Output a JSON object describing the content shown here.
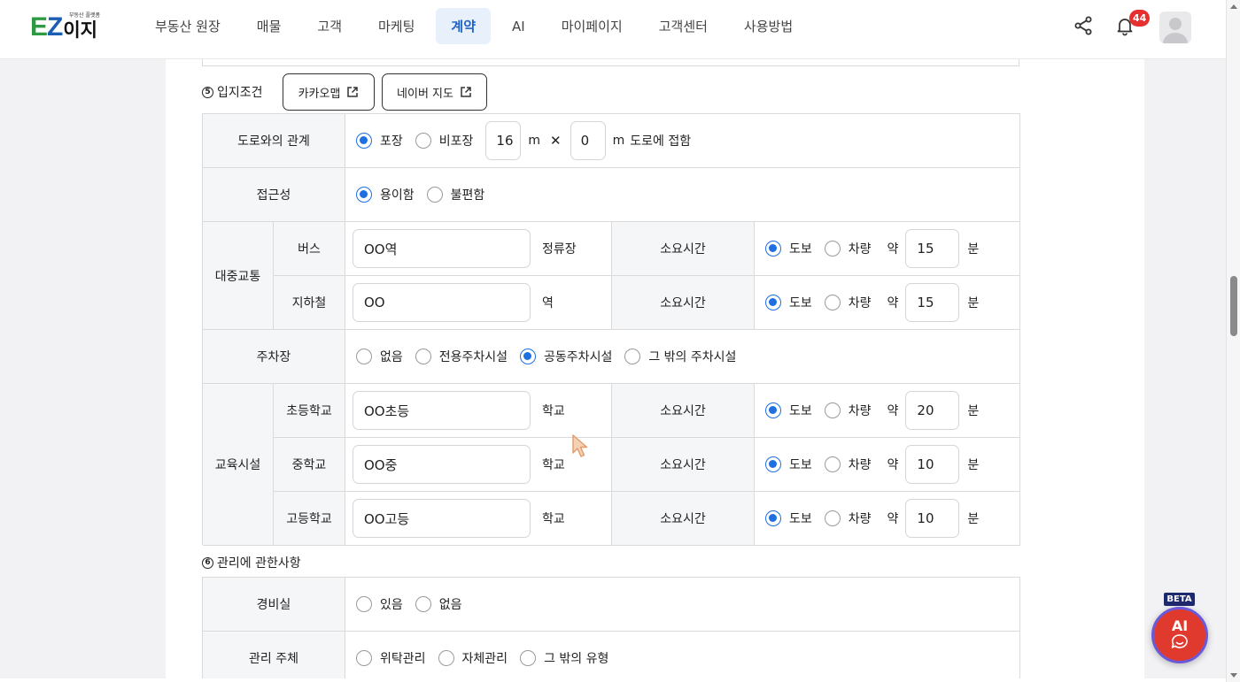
{
  "header": {
    "logo_ez": "EZ",
    "logo_ko": "이지",
    "logo_sub": "부동산 플랫폼",
    "nav": [
      {
        "label": "부동산 원장"
      },
      {
        "label": "매물"
      },
      {
        "label": "고객"
      },
      {
        "label": "마케팅"
      },
      {
        "label": "계약",
        "active": true
      },
      {
        "label": "AI"
      },
      {
        "label": "마이페이지"
      },
      {
        "label": "고객센터"
      },
      {
        "label": "사용방법"
      }
    ],
    "notification_count": "44",
    "icons": {
      "share": "share-icon",
      "bell": "bell-icon",
      "avatar": "user-avatar-icon"
    }
  },
  "section5": {
    "num": "5",
    "title": "입지조건",
    "kakao_btn": "카카오맵",
    "naver_btn": "네이버 지도"
  },
  "road": {
    "label": "도로와의 관계",
    "opt1": "포장",
    "opt2": "비포장",
    "width": "16",
    "m1": "m",
    "x": "✕",
    "depth": "0",
    "m2": "m",
    "suffix": "도로에 접함",
    "selected": "포장"
  },
  "access": {
    "label": "접근성",
    "opt1": "용이함",
    "opt2": "불편함",
    "selected": "용이함"
  },
  "transit": {
    "label": "대중교통",
    "rows": [
      {
        "label": "버스",
        "value": "OO역",
        "unit": "정류장",
        "time_label": "소요시간",
        "opt1": "도보",
        "opt2": "차량",
        "approx": "약",
        "minutes": "15",
        "min_unit": "분"
      },
      {
        "label": "지하철",
        "value": "OO",
        "unit": "역",
        "time_label": "소요시간",
        "opt1": "도보",
        "opt2": "차량",
        "approx": "약",
        "minutes": "15",
        "min_unit": "분"
      }
    ]
  },
  "parking": {
    "label": "주차장",
    "options": [
      "없음",
      "전용주차시설",
      "공동주차시설",
      "그 밖의 주차시설"
    ],
    "selected": "공동주차시설"
  },
  "education": {
    "label": "교육시설",
    "rows": [
      {
        "label": "초등학교",
        "value": "OO초등",
        "unit": "학교",
        "time_label": "소요시간",
        "opt1": "도보",
        "opt2": "차량",
        "approx": "약",
        "minutes": "20",
        "min_unit": "분"
      },
      {
        "label": "중학교",
        "value": "OO중",
        "unit": "학교",
        "time_label": "소요시간",
        "opt1": "도보",
        "opt2": "차량",
        "approx": "약",
        "minutes": "10",
        "min_unit": "분"
      },
      {
        "label": "고등학교",
        "value": "OO고등",
        "unit": "학교",
        "time_label": "소요시간",
        "opt1": "도보",
        "opt2": "차량",
        "approx": "약",
        "minutes": "10",
        "min_unit": "분"
      }
    ]
  },
  "section6": {
    "num": "6",
    "title": "관리에 관한사항"
  },
  "guard": {
    "label": "경비실",
    "opt1": "있음",
    "opt2": "없음"
  },
  "mgmt": {
    "label": "관리 주체",
    "opt1": "위탁관리",
    "opt2": "자체관리",
    "opt3": "그 밖의 유형"
  },
  "ai_widget": {
    "beta": "BETA",
    "label": "AI"
  },
  "colors": {
    "accent": "#1f6fe0",
    "active_nav_bg": "#e7f0fb",
    "badge": "#e63030",
    "ai_red": "#e03a2f"
  }
}
